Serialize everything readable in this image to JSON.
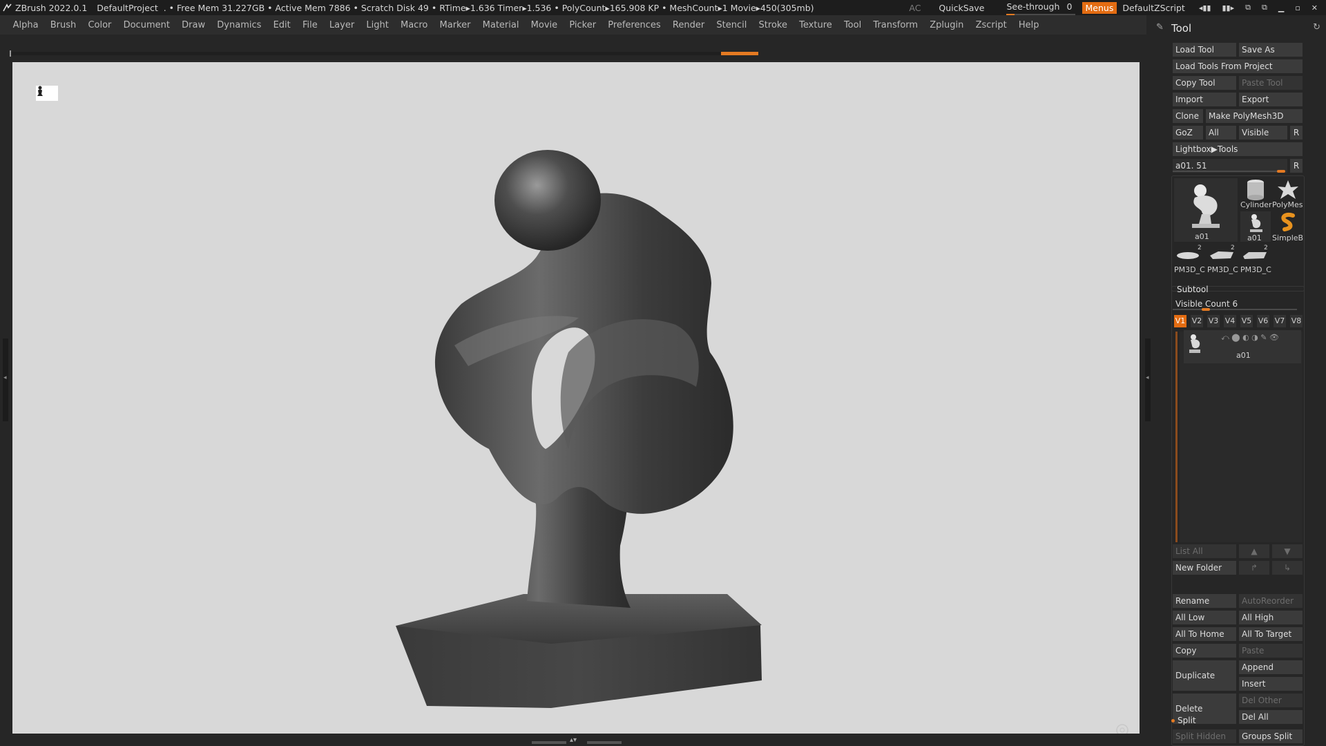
{
  "titlebar": {
    "app": "ZBrush 2022.0.1",
    "project": "DefaultProject",
    "status": ". • Free Mem 31.227GB • Active Mem 7886 • Scratch Disk 49 •  RTime▸1.636 Timer▸1.536 • PolyCount▸165.908 KP  • MeshCount▸1  Movie▸450(305mb)",
    "ac": "AC",
    "quicksave": "QuickSave",
    "see_through_label": "See-through",
    "see_through_value": "0",
    "see_through_level": 0,
    "menus": "Menus",
    "zscript": "DefaultZScript"
  },
  "menus": [
    "Alpha",
    "Brush",
    "Color",
    "Document",
    "Draw",
    "Dynamics",
    "Edit",
    "File",
    "Layer",
    "Light",
    "Macro",
    "Marker",
    "Material",
    "Movie",
    "Picker",
    "Preferences",
    "Render",
    "Stencil",
    "Stroke",
    "Texture",
    "Tool",
    "Transform",
    "Zplugin",
    "Zscript",
    "Help"
  ],
  "tool": {
    "title": "Tool",
    "load_tool": "Load Tool",
    "save_as": "Save As",
    "load_from_project": "Load Tools From Project",
    "copy_tool": "Copy Tool",
    "paste_tool": "Paste Tool",
    "import": "Import",
    "export": "Export",
    "clone": "Clone",
    "make_polymesh": "Make PolyMesh3D",
    "goz": "GoZ",
    "all": "All",
    "visible": "Visible",
    "r": "R",
    "lightbox": "Lightbox▶Tools",
    "current_tool": "a01. 51",
    "r2": "R",
    "thumbs": {
      "main": "a01",
      "cylinder": "Cylinder",
      "polymesh": "PolyMes",
      "a01_small": "a01",
      "simpleb": "SimpleB",
      "pm1": "PM3D_C",
      "pm2": "PM3D_C",
      "pm3": "PM3D_C",
      "pm_count1": "2",
      "pm_count2": "2",
      "pm_count3": "2"
    }
  },
  "subtool": {
    "title": "Subtool",
    "visible_count": "Visible Count 6",
    "visible_count_level": 6,
    "tabs": [
      "V1",
      "V2",
      "V3",
      "V4",
      "V5",
      "V6",
      "V7",
      "V8"
    ],
    "active_tab": "V1",
    "item_name": "a01",
    "list_all": "List All",
    "new_folder": "New Folder",
    "rename": "Rename",
    "auto_reorder": "AutoReorder",
    "all_low": "All Low",
    "all_high": "All High",
    "all_to_home": "All To Home",
    "all_to_target": "All To Target",
    "copy": "Copy",
    "paste": "Paste",
    "duplicate": "Duplicate",
    "append": "Append",
    "insert": "Insert",
    "delete": "Delete",
    "del_other": "Del Other",
    "del_all": "Del All",
    "split": "Split",
    "split_hidden": "Split Hidden",
    "groups_split": "Groups Split"
  },
  "colors": {
    "accent": "#e36c12",
    "canvas_bg": "#d8d8d8",
    "ui_bg": "#262626",
    "button_bg": "#3b3b3b"
  }
}
